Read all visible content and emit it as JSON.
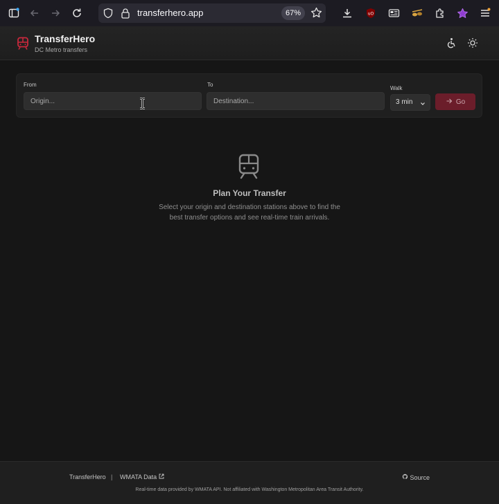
{
  "browser": {
    "url": "transferhero.app",
    "zoom": "67%"
  },
  "header": {
    "title": "TransferHero",
    "subtitle": "DC Metro transfers"
  },
  "search": {
    "from_label": "From",
    "from_placeholder": "Origin...",
    "to_label": "To",
    "to_placeholder": "Destination...",
    "walk_label": "Walk",
    "walk_value": "3 min",
    "go_label": "Go"
  },
  "empty_state": {
    "title": "Plan Your Transfer",
    "description": "Select your origin and destination stations above to find the best transfer options and see real-time train arrivals."
  },
  "footer": {
    "brand": "TransferHero",
    "separator": "|",
    "wmata_link": "WMATA Data",
    "source_link": "Source",
    "note": "Real-time data provided by WMATA API. Not affiliated with Washington Metropolitan Area Transit Authority."
  },
  "colors": {
    "accent": "#c8283c",
    "go_button": "#6b1d2a",
    "background": "#161616"
  }
}
